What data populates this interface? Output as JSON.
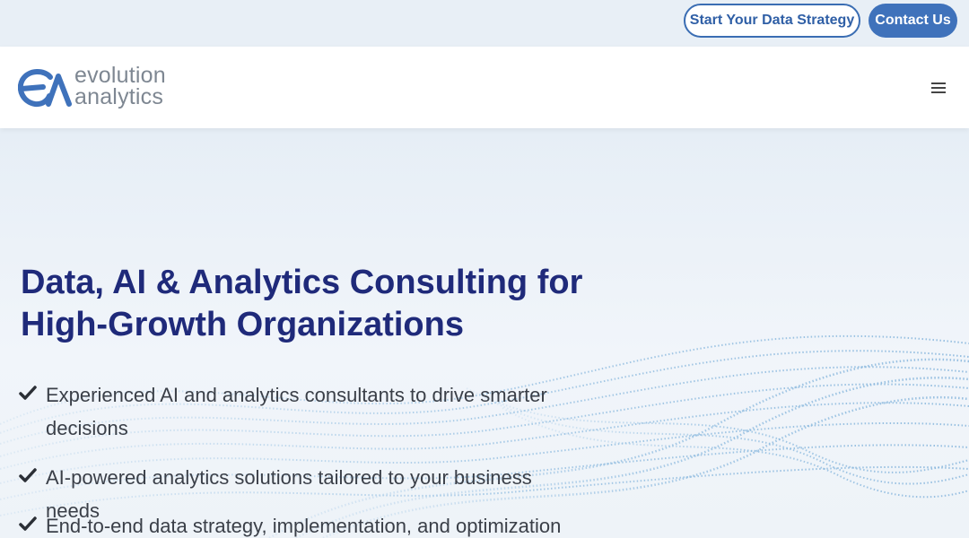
{
  "topbar": {
    "strategy_button": "Start Your Data Strategy",
    "contact_button": "Contact Us"
  },
  "header": {
    "logo": {
      "line1": "evolution",
      "line2": "analytics",
      "mark_icon": "ea-logo-mark"
    },
    "menu_icon": "hamburger-menu-icon"
  },
  "hero": {
    "title_line1": "Data, AI & Analytics Consulting for",
    "title_line2": "High-Growth Organizations",
    "bullets": [
      {
        "icon": "check-icon",
        "text": "Experienced AI and analytics consultants to drive smarter decisions"
      },
      {
        "icon": "check-icon",
        "text": "AI-powered analytics solutions tailored to your business needs"
      },
      {
        "icon": "check-icon",
        "text": "End-to-end data strategy, implementation, and optimization"
      }
    ]
  },
  "colors": {
    "brand_blue": "#3f72bb",
    "title_navy": "#1f2a7a",
    "logo_gray": "#7e8792",
    "wave_blue": "#9cc3e4"
  }
}
